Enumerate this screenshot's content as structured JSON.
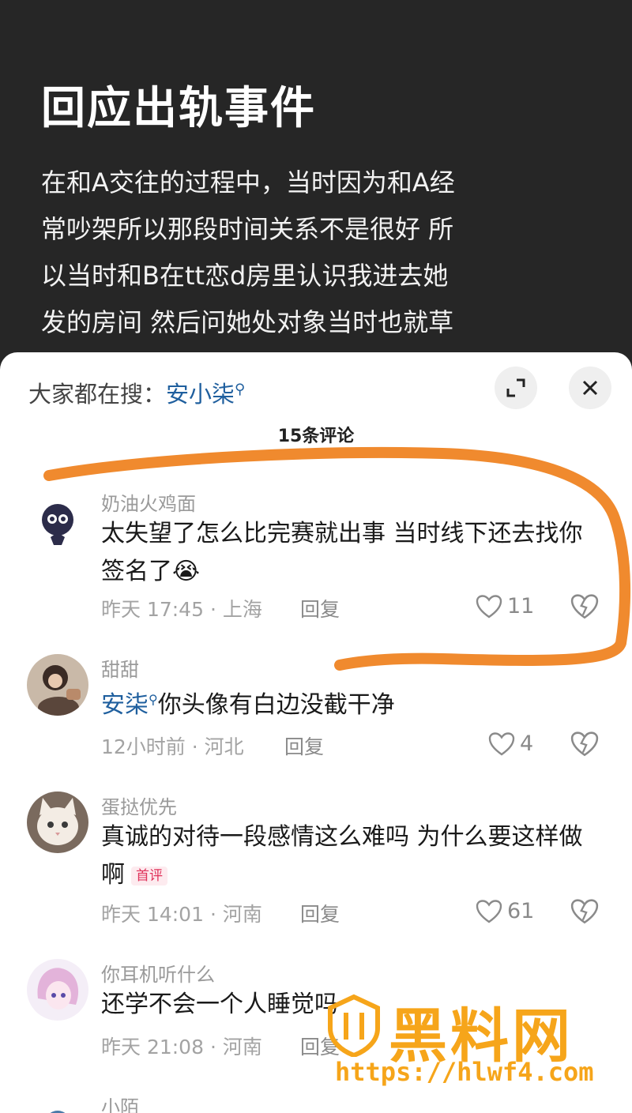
{
  "post": {
    "title": "回应出轨事件",
    "lines": [
      "在和A交往的过程中，当时因为和A经",
      "常吵架所以那段时间关系不是很好 所",
      "以当时和B在tt恋d房里认识我进去她",
      "发的房间 然后问她处对象当时也就草"
    ]
  },
  "sheet": {
    "search_prefix": "大家都在搜：",
    "search_term": "安小柒",
    "count_title": "15条评论"
  },
  "comments": [
    {
      "name": "奶油火鸡面",
      "text": "太失望了怎么比完赛就出事 当时线下还去找你签名了😭",
      "meta": "昨天 17:45 · 上海",
      "reply": "回复",
      "likes": "11"
    },
    {
      "name": "甜甜",
      "mention": "安柒",
      "text": "你头像有白边没截干净",
      "meta": "12小时前 · 河北",
      "reply": "回复",
      "likes": "4"
    },
    {
      "name": "蛋挞优先",
      "text": "真诚的对待一段感情这么难吗 为什么要这样做啊",
      "badge": "首评",
      "meta": "昨天 14:01 · 河南",
      "reply": "回复",
      "likes": "61"
    },
    {
      "name": "你耳机听什么",
      "text": "还学不会一个人睡觉吗",
      "meta": "昨天 21:08 · 河南",
      "reply": "回复",
      "likes": ""
    },
    {
      "name": "小陌"
    }
  ],
  "watermark": {
    "text": "黑料网",
    "url": "https://hlwf4.com"
  },
  "colors": {
    "highlight": "#f08a2e",
    "link": "#1f5f9e",
    "watermark": "#f6a51a"
  },
  "icons": [
    "expand-icon",
    "close-icon",
    "heart-icon",
    "broken-heart-icon",
    "search-mini-icon"
  ]
}
